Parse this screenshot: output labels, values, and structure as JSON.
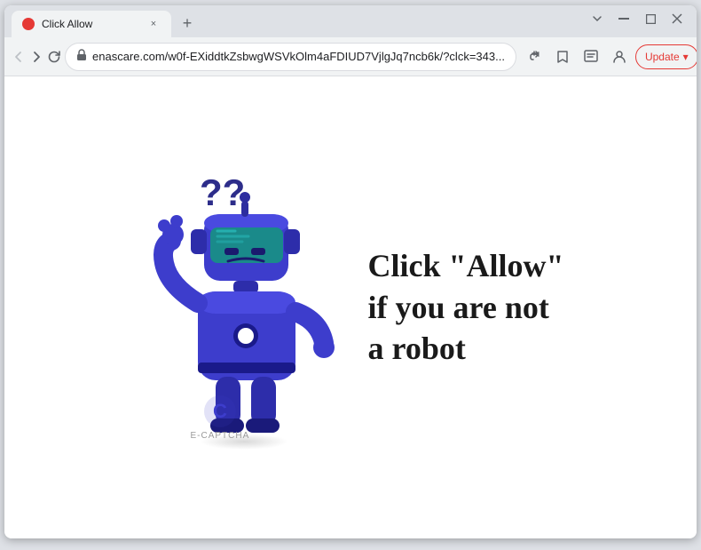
{
  "browser": {
    "tab": {
      "title": "Click Allow",
      "favicon_color": "#e53935"
    },
    "address": "enascare.com/w0f-EXiddtkZsbwgWSVkOlm4aFDIUD7VjlgJq7ncb6k/?clck=343...",
    "update_btn_label": "Update",
    "controls": {
      "minimize": "−",
      "maximize": "□",
      "close": "×",
      "new_tab": "+",
      "chevron_down": "⌄",
      "back": "←",
      "forward": "→",
      "reload": "↻",
      "menu_dots": "⋮"
    }
  },
  "page": {
    "main_text_line1": "Click \"Allow\"",
    "main_text_line2": "if you are not",
    "main_text_line3": "a robot",
    "captcha_label": "E-CAPTCHA"
  }
}
